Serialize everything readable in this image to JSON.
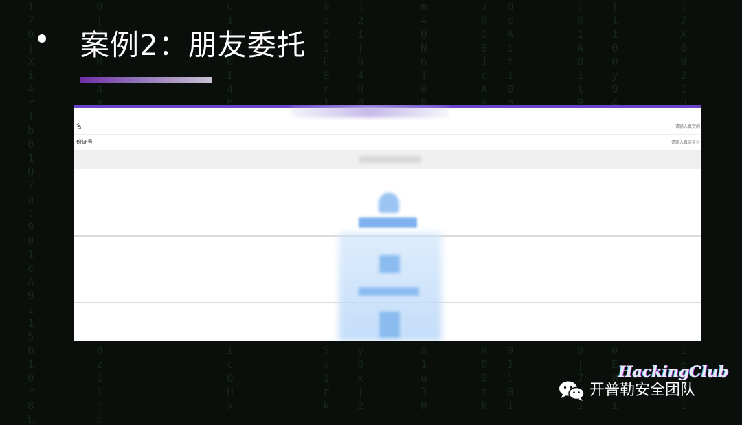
{
  "slide": {
    "title": "案例2：朋友委托"
  },
  "screenshot": {
    "rows": [
      {
        "label": "名",
        "hint": "请输入真实的"
      },
      {
        "label": "份证号",
        "hint": "请输入真实身份"
      }
    ]
  },
  "watermark": {
    "text": "开普勒安全团队",
    "logo": "HackingClub"
  },
  "colors": {
    "background": "#0b0f0c",
    "accent_purple": "#6a44c9",
    "underline_start": "#6f2da8",
    "upload_blue": "#7fb2ee"
  },
  "icons": [
    "bullet-icon",
    "wechat-icon",
    "upload-icon"
  ]
}
